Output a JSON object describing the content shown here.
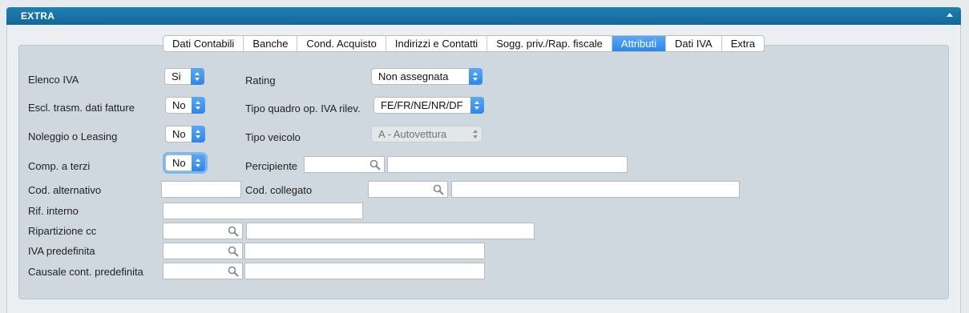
{
  "header": {
    "title": "EXTRA"
  },
  "tabs": [
    {
      "label": "Dati Contabili"
    },
    {
      "label": "Banche"
    },
    {
      "label": "Cond. Acquisto"
    },
    {
      "label": "Indirizzi e Contatti"
    },
    {
      "label": "Sogg. priv./Rap. fiscale"
    },
    {
      "label": "Attributi",
      "active": true
    },
    {
      "label": "Dati IVA"
    },
    {
      "label": "Extra"
    }
  ],
  "form": {
    "elenco_iva": {
      "label": "Elenco IVA",
      "value": "Si"
    },
    "escl_trasm": {
      "label": "Escl. trasm. dati fatture",
      "value": "No"
    },
    "noleggio": {
      "label": "Noleggio o Leasing",
      "value": "No"
    },
    "comp_terzi": {
      "label": "Comp.  a terzi",
      "value": "No"
    },
    "rating": {
      "label": "Rating",
      "value": "Non assegnata"
    },
    "tipo_quadro": {
      "label": "Tipo quadro op. IVA rilev.",
      "value": "FE/FR/NE/NR/DF"
    },
    "tipo_veicolo": {
      "label": "Tipo veicolo",
      "value": "A - Autovettura"
    },
    "percipiente": {
      "label": "Percipiente",
      "value": "",
      "desc": ""
    },
    "cod_alternativo": {
      "label": "Cod. alternativo",
      "value": ""
    },
    "cod_collegato": {
      "label": "Cod. collegato",
      "value": "",
      "desc": ""
    },
    "rif_interno": {
      "label": "Rif. interno",
      "value": ""
    },
    "ripartizione_cc": {
      "label": "Ripartizione cc",
      "value": "",
      "desc": ""
    },
    "iva_predefinita": {
      "label": "IVA predefinita",
      "value": "",
      "desc": ""
    },
    "causale_cont": {
      "label": "Causale cont. predefinita",
      "value": "",
      "desc": ""
    }
  },
  "colors": {
    "accent": "#2d86ea",
    "header": "#13679a"
  }
}
